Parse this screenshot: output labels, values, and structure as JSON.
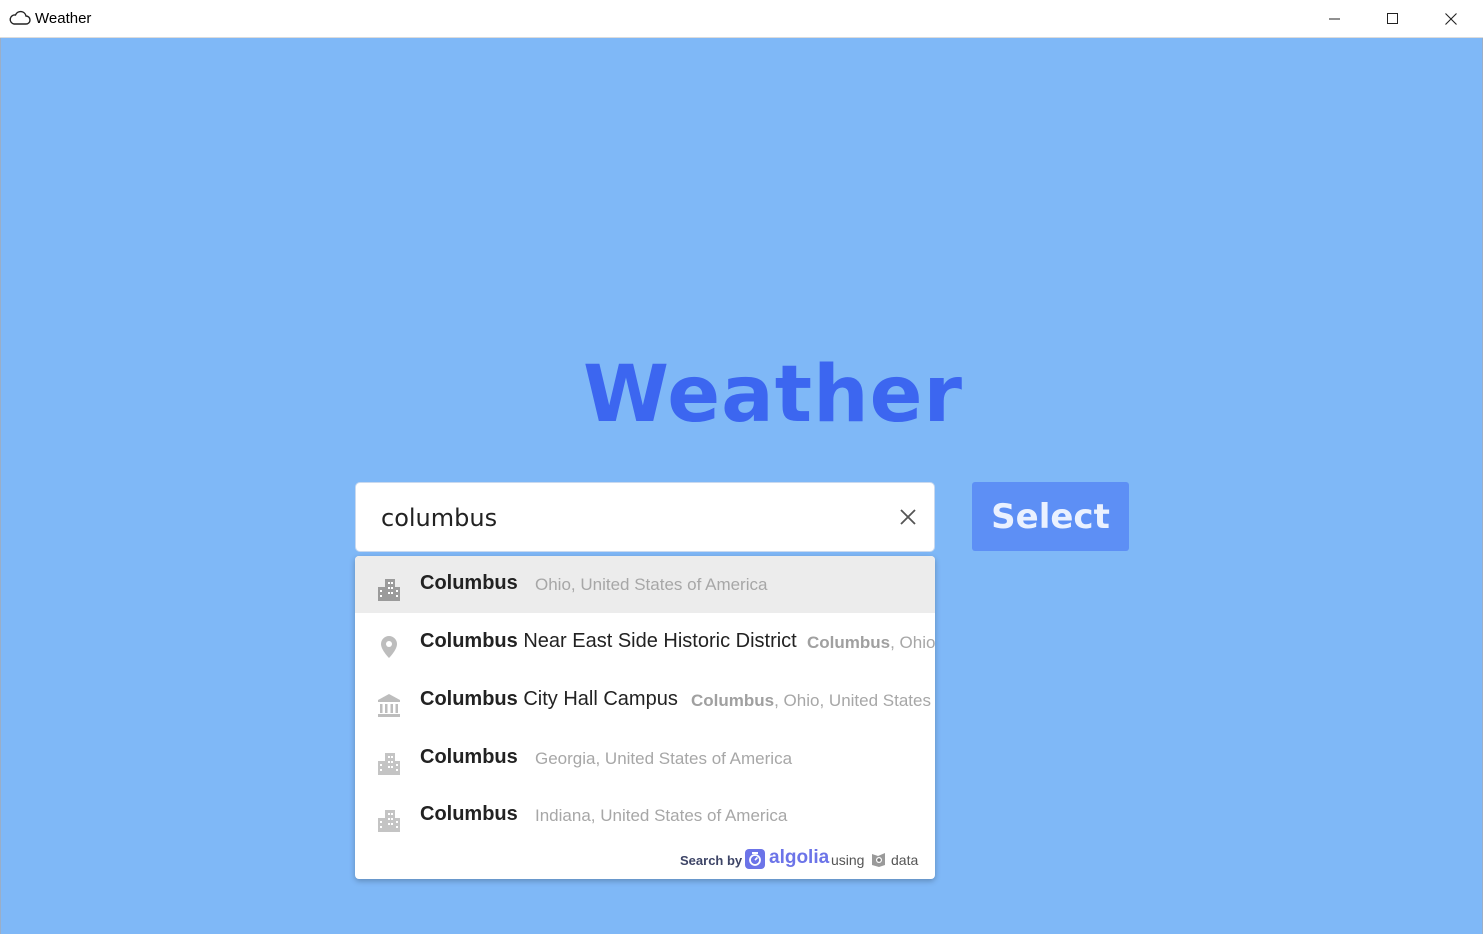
{
  "window": {
    "title": "Weather",
    "minimize_icon": "minimize-icon",
    "maximize_icon": "maximize-icon",
    "close_icon": "close-icon"
  },
  "colors": {
    "background": "#7fb8f7",
    "logo": "#3c66f0",
    "select_button": "#5d8ff5",
    "algolia": "#6c74e8"
  },
  "logo": {
    "text": "Weather"
  },
  "search": {
    "value": "columbus",
    "clear_icon": "close-icon"
  },
  "select_button": {
    "label": "Select"
  },
  "suggestions": [
    {
      "icon": "city-icon",
      "highlight": "Columbus",
      "rest": "",
      "sub_highlight": "",
      "sub": "Ohio, United States of America",
      "active": true
    },
    {
      "icon": "location-pin-icon",
      "highlight": "Columbus",
      "rest": " Near East Side Historic District",
      "sub_highlight": "Columbus",
      "sub": ", Ohio,",
      "active": false
    },
    {
      "icon": "townhall-icon",
      "highlight": "Columbus",
      "rest": " City Hall Campus",
      "sub_highlight": "Columbus",
      "sub": ", Ohio, United States",
      "active": false
    },
    {
      "icon": "city-icon",
      "highlight": "Columbus",
      "rest": "",
      "sub_highlight": "",
      "sub": "Georgia, United States of America",
      "active": false
    },
    {
      "icon": "city-icon",
      "highlight": "Columbus",
      "rest": "",
      "sub_highlight": "",
      "sub": "Indiana, United States of America",
      "active": false
    }
  ],
  "footer": {
    "search_by": "Search by",
    "algolia": "algolia",
    "using": "using",
    "data": "data"
  }
}
